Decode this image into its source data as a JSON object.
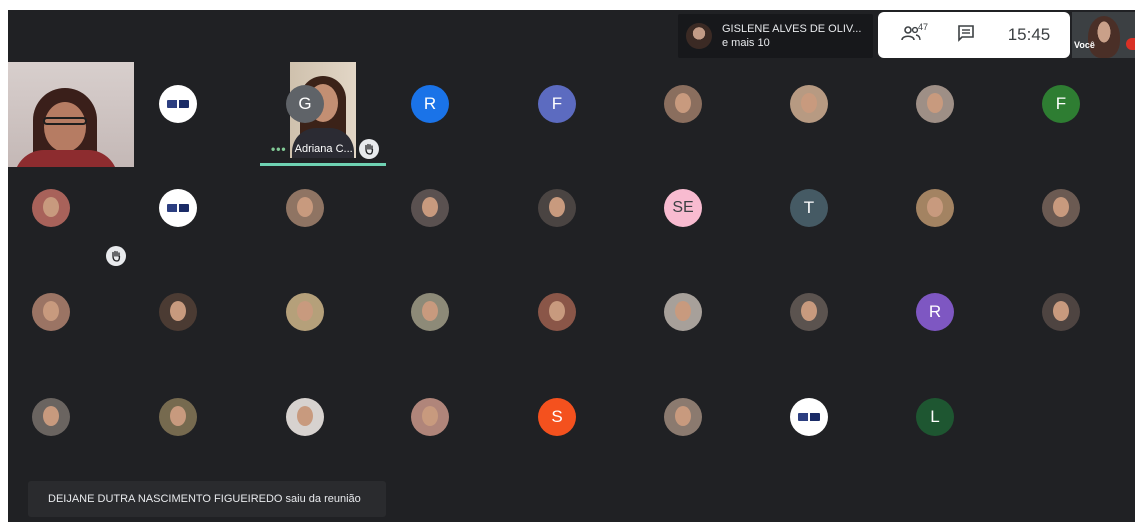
{
  "top_bar": {
    "speaker_name": "GISLENE ALVES DE OLIV...",
    "speaker_more": "e mais 10",
    "participants_count": "47",
    "clock": "15:45",
    "self_label": "Você"
  },
  "featured": {
    "pinned_name": "Adriana C..."
  },
  "grid": [
    {
      "kind": "logo"
    },
    {
      "kind": "letter",
      "letter": "G",
      "color": "#5f6368"
    },
    {
      "kind": "letter",
      "letter": "R",
      "color": "#1a73e8"
    },
    {
      "kind": "letter",
      "letter": "F",
      "color": "#5c6bc0"
    },
    {
      "kind": "photo",
      "bg": "#8a6e5e"
    },
    {
      "kind": "photo",
      "bg": "#b79a82"
    },
    {
      "kind": "photo",
      "bg": "#9e8f86"
    },
    {
      "kind": "letter",
      "letter": "F",
      "color": "#2e7d32"
    },
    {
      "kind": "photo",
      "bg": "#a8625a"
    },
    {
      "kind": "logo"
    },
    {
      "kind": "photo",
      "bg": "#8f7463"
    },
    {
      "kind": "photo",
      "bg": "#5a5150"
    },
    {
      "kind": "photo",
      "bg": "#4a4442"
    },
    {
      "kind": "letter",
      "letter": "SE",
      "color": "#f8bbd0"
    },
    {
      "kind": "letter",
      "letter": "T",
      "color": "#455a64"
    },
    {
      "kind": "photo",
      "bg": "#a38362"
    },
    {
      "kind": "photo",
      "bg": "#6b5a52"
    },
    {
      "kind": "photo",
      "bg": "#9b7464"
    },
    {
      "kind": "photo",
      "bg": "#4b3b33"
    },
    {
      "kind": "photo",
      "bg": "#b5a07a"
    },
    {
      "kind": "photo",
      "bg": "#8d8a78"
    },
    {
      "kind": "photo",
      "bg": "#8a5648"
    },
    {
      "kind": "photo",
      "bg": "#a7a09a"
    },
    {
      "kind": "photo",
      "bg": "#5b534f"
    },
    {
      "kind": "letter",
      "letter": "R",
      "color": "#7e57c2"
    },
    {
      "kind": "photo",
      "bg": "#4e4441"
    },
    {
      "kind": "photo",
      "bg": "#6a6460"
    },
    {
      "kind": "photo",
      "bg": "#766a4f"
    },
    {
      "kind": "photo",
      "bg": "#d7d2cf"
    },
    {
      "kind": "photo",
      "bg": "#b0857a"
    },
    {
      "kind": "letter",
      "letter": "S",
      "color": "#f4511e"
    },
    {
      "kind": "photo",
      "bg": "#8b7a6f"
    },
    {
      "kind": "logo"
    },
    {
      "kind": "letter",
      "letter": "L",
      "color": "#1e5631"
    }
  ],
  "toast": {
    "message": "DEIJANE DUTRA NASCIMENTO FIGUEIREDO saiu da reunião"
  },
  "icons": {
    "participants": "people-icon",
    "chat": "chat-icon",
    "hand": "raised-hand-icon"
  }
}
